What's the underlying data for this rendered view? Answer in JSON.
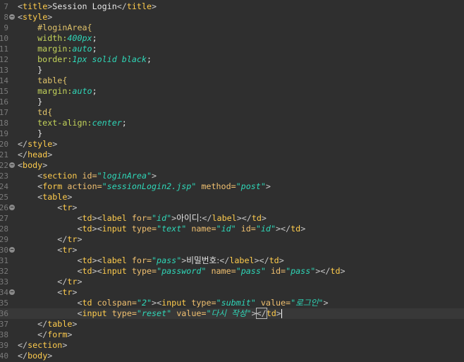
{
  "editor": {
    "lines": [
      {
        "n": "7",
        "fold": false,
        "tokens": [
          {
            "t": "<",
            "c": "bracket"
          },
          {
            "t": "title",
            "c": "tag"
          },
          {
            "t": ">",
            "c": "bracket"
          },
          {
            "t": "Session Login",
            "c": "plain"
          },
          {
            "t": "</",
            "c": "bracket"
          },
          {
            "t": "title",
            "c": "tag"
          },
          {
            "t": ">",
            "c": "bracket"
          }
        ]
      },
      {
        "n": "8",
        "fold": true,
        "tokens": [
          {
            "t": "<",
            "c": "bracket"
          },
          {
            "t": "style",
            "c": "tag"
          },
          {
            "t": ">",
            "c": "bracket"
          }
        ]
      },
      {
        "n": "9",
        "fold": false,
        "tokens": [
          {
            "t": "    #loginArea{",
            "c": "sel"
          }
        ]
      },
      {
        "n": "10",
        "fold": false,
        "tokens": [
          {
            "t": "    width:",
            "c": "prop"
          },
          {
            "t": "400px",
            "c": "pval"
          },
          {
            "t": ";",
            "c": "plain"
          }
        ]
      },
      {
        "n": "11",
        "fold": false,
        "tokens": [
          {
            "t": "    margin:",
            "c": "prop"
          },
          {
            "t": "auto",
            "c": "pval"
          },
          {
            "t": ";",
            "c": "plain"
          }
        ]
      },
      {
        "n": "12",
        "fold": false,
        "tokens": [
          {
            "t": "    border:",
            "c": "prop"
          },
          {
            "t": "1px solid black",
            "c": "pval"
          },
          {
            "t": ";",
            "c": "plain"
          }
        ]
      },
      {
        "n": "13",
        "fold": false,
        "tokens": [
          {
            "t": "    }",
            "c": "plain"
          }
        ]
      },
      {
        "n": "14",
        "fold": false,
        "tokens": [
          {
            "t": "    table{",
            "c": "sel"
          }
        ]
      },
      {
        "n": "15",
        "fold": false,
        "tokens": [
          {
            "t": "    margin:",
            "c": "prop"
          },
          {
            "t": "auto",
            "c": "pval"
          },
          {
            "t": ";",
            "c": "plain"
          }
        ]
      },
      {
        "n": "16",
        "fold": false,
        "tokens": [
          {
            "t": "    }",
            "c": "plain"
          }
        ]
      },
      {
        "n": "17",
        "fold": false,
        "tokens": [
          {
            "t": "    td{",
            "c": "sel"
          }
        ]
      },
      {
        "n": "18",
        "fold": false,
        "tokens": [
          {
            "t": "    text-align:",
            "c": "prop"
          },
          {
            "t": "center",
            "c": "pval"
          },
          {
            "t": ";",
            "c": "plain"
          }
        ]
      },
      {
        "n": "19",
        "fold": false,
        "tokens": [
          {
            "t": "    }",
            "c": "plain"
          }
        ]
      },
      {
        "n": "20",
        "fold": false,
        "tokens": [
          {
            "t": "</",
            "c": "bracket"
          },
          {
            "t": "style",
            "c": "tag"
          },
          {
            "t": ">",
            "c": "bracket"
          }
        ]
      },
      {
        "n": "21",
        "fold": false,
        "tokens": [
          {
            "t": "</",
            "c": "bracket"
          },
          {
            "t": "head",
            "c": "tag"
          },
          {
            "t": ">",
            "c": "bracket"
          }
        ]
      },
      {
        "n": "22",
        "fold": true,
        "tokens": [
          {
            "t": "<",
            "c": "bracket"
          },
          {
            "t": "body",
            "c": "tag"
          },
          {
            "t": ">",
            "c": "bracket"
          }
        ]
      },
      {
        "n": "23",
        "fold": false,
        "tokens": [
          {
            "t": "    <",
            "c": "bracket"
          },
          {
            "t": "section",
            "c": "tag"
          },
          {
            "t": " id=",
            "c": "attr"
          },
          {
            "t": "\"loginArea\"",
            "c": "val"
          },
          {
            "t": ">",
            "c": "bracket"
          }
        ]
      },
      {
        "n": "24",
        "fold": false,
        "tokens": [
          {
            "t": "    <",
            "c": "bracket"
          },
          {
            "t": "form",
            "c": "tag"
          },
          {
            "t": " action=",
            "c": "attr"
          },
          {
            "t": "\"sessionLogin2.jsp\"",
            "c": "val"
          },
          {
            "t": " method=",
            "c": "attr"
          },
          {
            "t": "\"post\"",
            "c": "val"
          },
          {
            "t": ">",
            "c": "bracket"
          }
        ]
      },
      {
        "n": "25",
        "fold": false,
        "tokens": [
          {
            "t": "    <",
            "c": "bracket"
          },
          {
            "t": "table",
            "c": "tag"
          },
          {
            "t": ">",
            "c": "bracket"
          }
        ]
      },
      {
        "n": "26",
        "fold": true,
        "tokens": [
          {
            "t": "        <",
            "c": "bracket"
          },
          {
            "t": "tr",
            "c": "tag"
          },
          {
            "t": ">",
            "c": "bracket"
          }
        ]
      },
      {
        "n": "27",
        "fold": false,
        "tokens": [
          {
            "t": "            <",
            "c": "bracket"
          },
          {
            "t": "td",
            "c": "tag"
          },
          {
            "t": "><",
            "c": "bracket"
          },
          {
            "t": "label",
            "c": "tag"
          },
          {
            "t": " for=",
            "c": "attr"
          },
          {
            "t": "\"id\"",
            "c": "val"
          },
          {
            "t": ">",
            "c": "bracket"
          },
          {
            "t": "아이디:",
            "c": "kor"
          },
          {
            "t": "</",
            "c": "bracket"
          },
          {
            "t": "label",
            "c": "tag"
          },
          {
            "t": "></",
            "c": "bracket"
          },
          {
            "t": "td",
            "c": "tag"
          },
          {
            "t": ">",
            "c": "bracket"
          }
        ]
      },
      {
        "n": "28",
        "fold": false,
        "tokens": [
          {
            "t": "            <",
            "c": "bracket"
          },
          {
            "t": "td",
            "c": "tag"
          },
          {
            "t": "><",
            "c": "bracket"
          },
          {
            "t": "input",
            "c": "tag"
          },
          {
            "t": " type=",
            "c": "attr"
          },
          {
            "t": "\"text\"",
            "c": "val"
          },
          {
            "t": " name=",
            "c": "attr"
          },
          {
            "t": "\"id\"",
            "c": "val"
          },
          {
            "t": " id=",
            "c": "attr"
          },
          {
            "t": "\"id\"",
            "c": "val"
          },
          {
            "t": "></",
            "c": "bracket"
          },
          {
            "t": "td",
            "c": "tag"
          },
          {
            "t": ">",
            "c": "bracket"
          }
        ]
      },
      {
        "n": "29",
        "fold": false,
        "tokens": [
          {
            "t": "        </",
            "c": "bracket"
          },
          {
            "t": "tr",
            "c": "tag"
          },
          {
            "t": ">",
            "c": "bracket"
          }
        ]
      },
      {
        "n": "30",
        "fold": true,
        "tokens": [
          {
            "t": "        <",
            "c": "bracket"
          },
          {
            "t": "tr",
            "c": "tag"
          },
          {
            "t": ">",
            "c": "bracket"
          }
        ]
      },
      {
        "n": "31",
        "fold": false,
        "tokens": [
          {
            "t": "            <",
            "c": "bracket"
          },
          {
            "t": "td",
            "c": "tag"
          },
          {
            "t": "><",
            "c": "bracket"
          },
          {
            "t": "label",
            "c": "tag"
          },
          {
            "t": " for=",
            "c": "attr"
          },
          {
            "t": "\"pass\"",
            "c": "val"
          },
          {
            "t": ">",
            "c": "bracket"
          },
          {
            "t": "비밀번호:",
            "c": "kor"
          },
          {
            "t": "</",
            "c": "bracket"
          },
          {
            "t": "label",
            "c": "tag"
          },
          {
            "t": "></",
            "c": "bracket"
          },
          {
            "t": "td",
            "c": "tag"
          },
          {
            "t": ">",
            "c": "bracket"
          }
        ]
      },
      {
        "n": "32",
        "fold": false,
        "tokens": [
          {
            "t": "            <",
            "c": "bracket"
          },
          {
            "t": "td",
            "c": "tag"
          },
          {
            "t": "><",
            "c": "bracket"
          },
          {
            "t": "input",
            "c": "tag"
          },
          {
            "t": " type=",
            "c": "attr"
          },
          {
            "t": "\"password\"",
            "c": "val"
          },
          {
            "t": " name=",
            "c": "attr"
          },
          {
            "t": "\"pass\"",
            "c": "val"
          },
          {
            "t": " id=",
            "c": "attr"
          },
          {
            "t": "\"pass\"",
            "c": "val"
          },
          {
            "t": "></",
            "c": "bracket"
          },
          {
            "t": "td",
            "c": "tag"
          },
          {
            "t": ">",
            "c": "bracket"
          }
        ]
      },
      {
        "n": "33",
        "fold": false,
        "tokens": [
          {
            "t": "        </",
            "c": "bracket"
          },
          {
            "t": "tr",
            "c": "tag"
          },
          {
            "t": ">",
            "c": "bracket"
          }
        ]
      },
      {
        "n": "34",
        "fold": true,
        "tokens": [
          {
            "t": "        <",
            "c": "bracket"
          },
          {
            "t": "tr",
            "c": "tag"
          },
          {
            "t": ">",
            "c": "bracket"
          }
        ]
      },
      {
        "n": "35",
        "fold": false,
        "tokens": [
          {
            "t": "            <",
            "c": "bracket"
          },
          {
            "t": "td",
            "c": "tag"
          },
          {
            "t": " colspan=",
            "c": "attr"
          },
          {
            "t": "\"2\"",
            "c": "val"
          },
          {
            "t": "><",
            "c": "bracket"
          },
          {
            "t": "input",
            "c": "tag"
          },
          {
            "t": " type=",
            "c": "attr"
          },
          {
            "t": "\"submit\"",
            "c": "val"
          },
          {
            "t": " value=",
            "c": "attr"
          },
          {
            "t": "\"로그인\"",
            "c": "val"
          },
          {
            "t": ">",
            "c": "bracket"
          }
        ]
      },
      {
        "n": "36",
        "fold": false,
        "active": true,
        "tokens": [
          {
            "t": "            <",
            "c": "bracket"
          },
          {
            "t": "input",
            "c": "tag"
          },
          {
            "t": " type=",
            "c": "attr"
          },
          {
            "t": "\"reset\"",
            "c": "val"
          },
          {
            "t": " value=",
            "c": "attr"
          },
          {
            "t": "\"다시 작성\"",
            "c": "val"
          },
          {
            "t": ">",
            "c": "bracket"
          },
          {
            "t": "</",
            "c": "bracket match"
          },
          {
            "t": "td",
            "c": "tag"
          },
          {
            "t": ">",
            "c": "bracket"
          },
          {
            "t": "",
            "c": "caret"
          }
        ]
      },
      {
        "n": "37",
        "fold": false,
        "tokens": [
          {
            "t": "    </",
            "c": "bracket"
          },
          {
            "t": "table",
            "c": "tag"
          },
          {
            "t": ">",
            "c": "bracket"
          }
        ]
      },
      {
        "n": "38",
        "fold": false,
        "tokens": [
          {
            "t": "    </",
            "c": "bracket"
          },
          {
            "t": "form",
            "c": "tag"
          },
          {
            "t": ">",
            "c": "bracket"
          }
        ]
      },
      {
        "n": "39",
        "fold": false,
        "tokens": [
          {
            "t": "</",
            "c": "bracket"
          },
          {
            "t": "section",
            "c": "tag"
          },
          {
            "t": ">",
            "c": "bracket"
          }
        ]
      },
      {
        "n": "40",
        "fold": false,
        "tokens": [
          {
            "t": "</",
            "c": "bracket"
          },
          {
            "t": "body",
            "c": "tag"
          },
          {
            "t": ">",
            "c": "bracket"
          }
        ]
      }
    ]
  }
}
